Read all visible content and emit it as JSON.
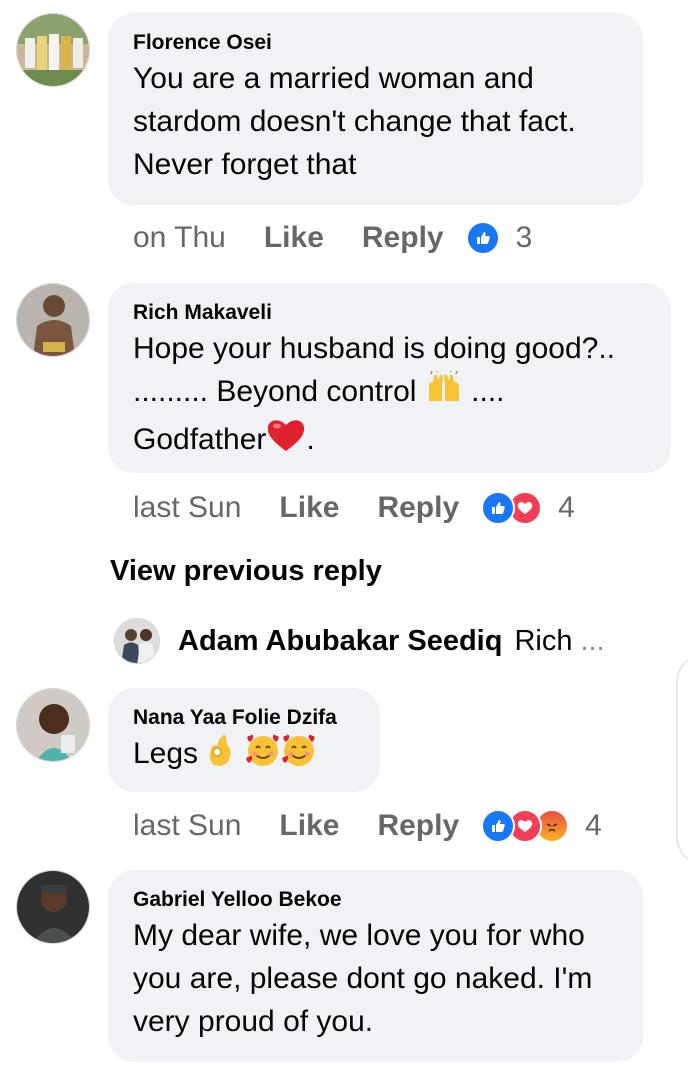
{
  "comments": [
    {
      "author": "Florence Osei",
      "lines": [
        "You are a married woman and",
        "stardom doesn't change that fact.",
        "Never forget that"
      ],
      "time": "on Thu",
      "like": "Like",
      "reply": "Reply",
      "reaction_count": "3",
      "reactions": [
        "like"
      ]
    },
    {
      "author": "Rich Makaveli",
      "line1": "Hope your husband is doing good?..",
      "line2_a": "......... Beyond control",
      "line2_b": "....",
      "line3_a": "Godfather",
      "line3_b": ".",
      "time": "last Sun",
      "like": "Like",
      "reply": "Reply",
      "reaction_count": "4",
      "reactions": [
        "like",
        "love"
      ]
    },
    {
      "author": "Nana Yaa Folie Dzifa",
      "text": "Legs",
      "time": "last Sun",
      "like": "Like",
      "reply": "Reply",
      "reaction_count": "4",
      "reactions": [
        "like",
        "love",
        "angry"
      ]
    },
    {
      "author": "Gabriel Yelloo Bekoe",
      "lines": [
        "My dear wife, we love you for who",
        "you are, please dont go naked. I'm",
        "very proud of you."
      ]
    }
  ],
  "view_previous": "View previous reply",
  "reply_preview": {
    "author": "Adam Abubakar Seediq",
    "text": "Rich",
    "ellipsis": "..."
  },
  "colors": {
    "bubble": "#f0f2f5",
    "meta_text": "#65676b",
    "like_blue": "#1877f2",
    "love_red": "#f33e58",
    "angry_orange": "#f7b125"
  },
  "icons": [
    "like-reaction-icon",
    "love-reaction-icon",
    "angry-reaction-icon",
    "raising-hands-emoji",
    "red-heart-emoji",
    "ok-hand-emoji",
    "smiling-face-with-hearts-emoji"
  ]
}
